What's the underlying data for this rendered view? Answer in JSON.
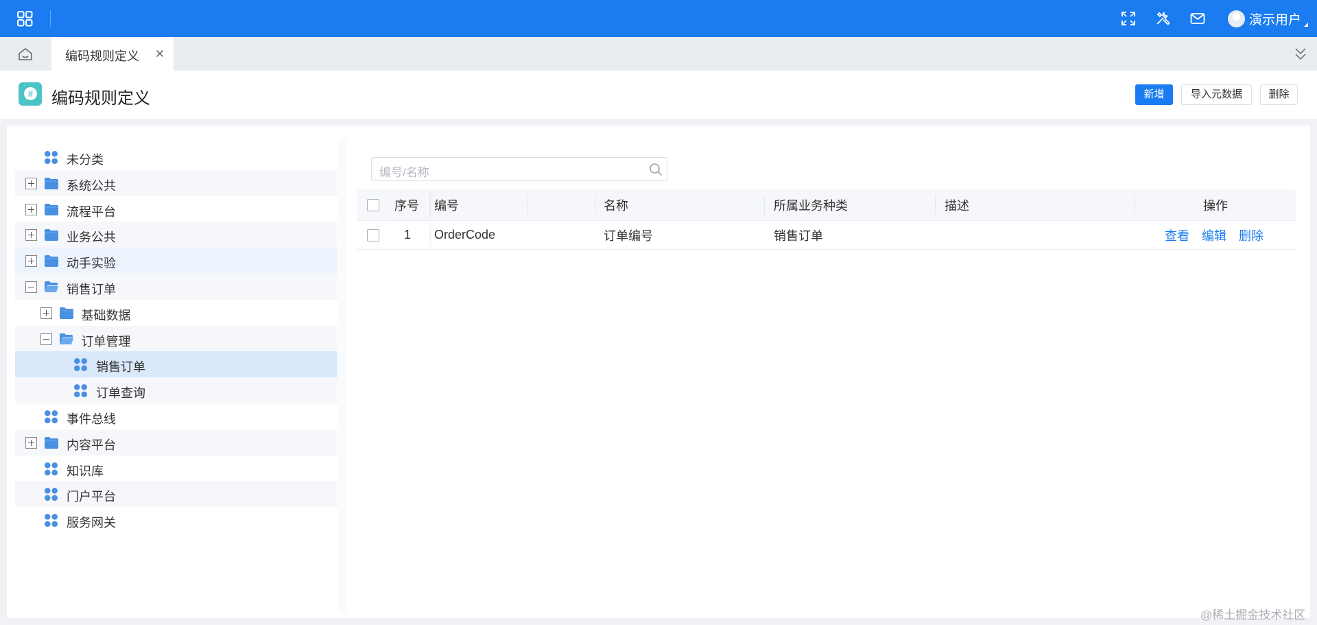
{
  "topbar": {
    "user_name": "演示用户",
    "brand_color": "#1a7cf0",
    "icons": [
      "apps-grid-icon",
      "fullscreen-icon",
      "tools-icon",
      "mail-icon",
      "avatar"
    ]
  },
  "tabs": [
    {
      "label": "编码规则定义",
      "closable": true
    }
  ],
  "page": {
    "title": "编码规则定义",
    "logo_glyph": "#",
    "actions": {
      "add": "新增",
      "import": "导入元数据",
      "delete": "删除"
    }
  },
  "tree": [
    {
      "label": "未分类",
      "type": "leaf",
      "level": 0,
      "toggle": null
    },
    {
      "label": "系统公共",
      "type": "folder",
      "level": 0,
      "toggle": "plus"
    },
    {
      "label": "流程平台",
      "type": "folder",
      "level": 0,
      "toggle": "plus"
    },
    {
      "label": "业务公共",
      "type": "folder",
      "level": 0,
      "toggle": "plus"
    },
    {
      "label": "动手实验",
      "type": "folder",
      "level": 0,
      "toggle": "plus"
    },
    {
      "label": "销售订单",
      "type": "folder-open",
      "level": 0,
      "toggle": "minus"
    },
    {
      "label": "基础数据",
      "type": "folder",
      "level": 1,
      "toggle": "plus"
    },
    {
      "label": "订单管理",
      "type": "folder-open",
      "level": 1,
      "toggle": "minus"
    },
    {
      "label": "销售订单",
      "type": "leaf",
      "level": 2,
      "toggle": null,
      "selected": true
    },
    {
      "label": "订单查询",
      "type": "leaf",
      "level": 2,
      "toggle": null
    },
    {
      "label": "事件总线",
      "type": "leaf",
      "level": 0,
      "toggle": null
    },
    {
      "label": "内容平台",
      "type": "folder",
      "level": 0,
      "toggle": "plus"
    },
    {
      "label": "知识库",
      "type": "leaf",
      "level": 0,
      "toggle": null
    },
    {
      "label": "门户平台",
      "type": "leaf",
      "level": 0,
      "toggle": null
    },
    {
      "label": "服务网关",
      "type": "leaf",
      "level": 0,
      "toggle": null
    }
  ],
  "search": {
    "placeholder": "编号/名称"
  },
  "table": {
    "headers": {
      "seq": "序号",
      "code": "编号",
      "name": "名称",
      "category": "所属业务种类",
      "desc": "描述",
      "ops": "操作"
    },
    "rows": [
      {
        "seq": "1",
        "code": "OrderCode",
        "name": "订单编号",
        "category": "销售订单",
        "desc": "",
        "ops": {
          "view": "查看",
          "edit": "编辑",
          "delete": "删除"
        }
      }
    ]
  },
  "watermark": "@稀土掘金技术社区"
}
